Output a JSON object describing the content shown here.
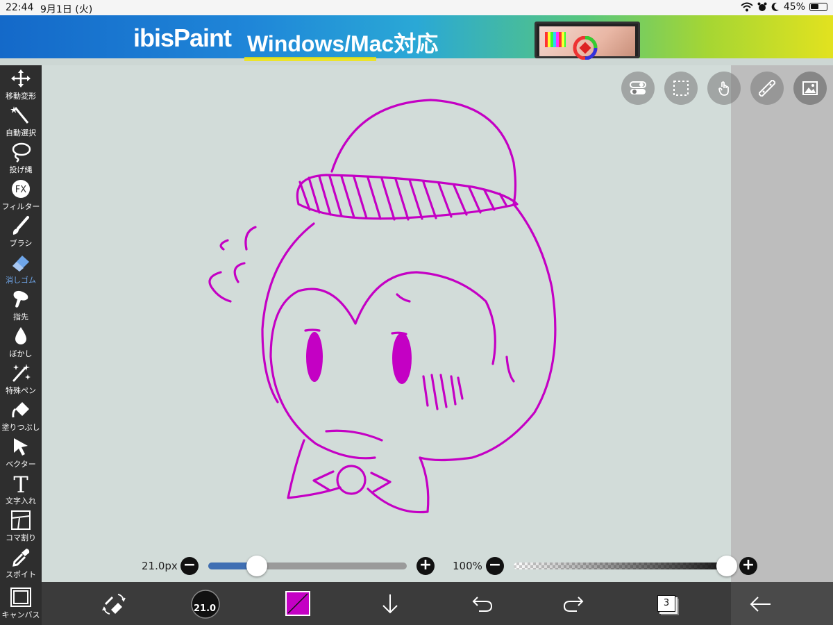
{
  "status_bar": {
    "time": "22:44",
    "date": "9月1日 (火)",
    "battery_text": "45%",
    "battery_level": 0.45
  },
  "banner": {
    "brand": "ibisPaint",
    "tagline": "Windows/Mac対応"
  },
  "tools": [
    {
      "label": "移動変形",
      "icon": "move-icon"
    },
    {
      "label": "自動選択",
      "icon": "magic-wand-icon"
    },
    {
      "label": "投げ縄",
      "icon": "lasso-icon"
    },
    {
      "label": "フィルター",
      "icon": "filter-fx-icon"
    },
    {
      "label": "ブラシ",
      "icon": "brush-icon"
    },
    {
      "label": "消しゴム",
      "icon": "eraser-icon",
      "active": true
    },
    {
      "label": "指先",
      "icon": "finger-icon"
    },
    {
      "label": "ぼかし",
      "icon": "blur-drop-icon"
    },
    {
      "label": "特殊ペン",
      "icon": "special-pen-icon"
    },
    {
      "label": "塗りつぶし",
      "icon": "fill-bucket-icon"
    },
    {
      "label": "ベクター",
      "icon": "vector-cursor-icon"
    },
    {
      "label": "文字入れ",
      "icon": "text-icon"
    },
    {
      "label": "コマ割り",
      "icon": "frame-divider-icon"
    },
    {
      "label": "スポイト",
      "icon": "eyedropper-icon"
    },
    {
      "label": "キャンバス",
      "icon": "canvas-icon"
    }
  ],
  "top_buttons": [
    "toggle-icon",
    "selection-rect-icon",
    "touch-icon",
    "ruler-icon",
    "reference-image-icon"
  ],
  "brush_size": {
    "text": "21.0px",
    "value": 21.0
  },
  "opacity": {
    "text": "100%",
    "value": 100
  },
  "bottom_bar": {
    "brush_preview_text": "21.0",
    "color": "#c400c4",
    "layer_count": "3",
    "icons": [
      "swap-brush-eraser-icon",
      "brush-preview-icon",
      "color-swatch-icon",
      "download-arrow-icon",
      "undo-icon",
      "redo-icon",
      "layers-icon",
      "back-arrow-icon"
    ]
  },
  "colors": {
    "stroke": "#c400c4",
    "canvas": "#d2dcd9",
    "toolbar": "#2e2e2e",
    "active_tool": "#6fa6ea",
    "size_track": "#3f6fb3"
  }
}
